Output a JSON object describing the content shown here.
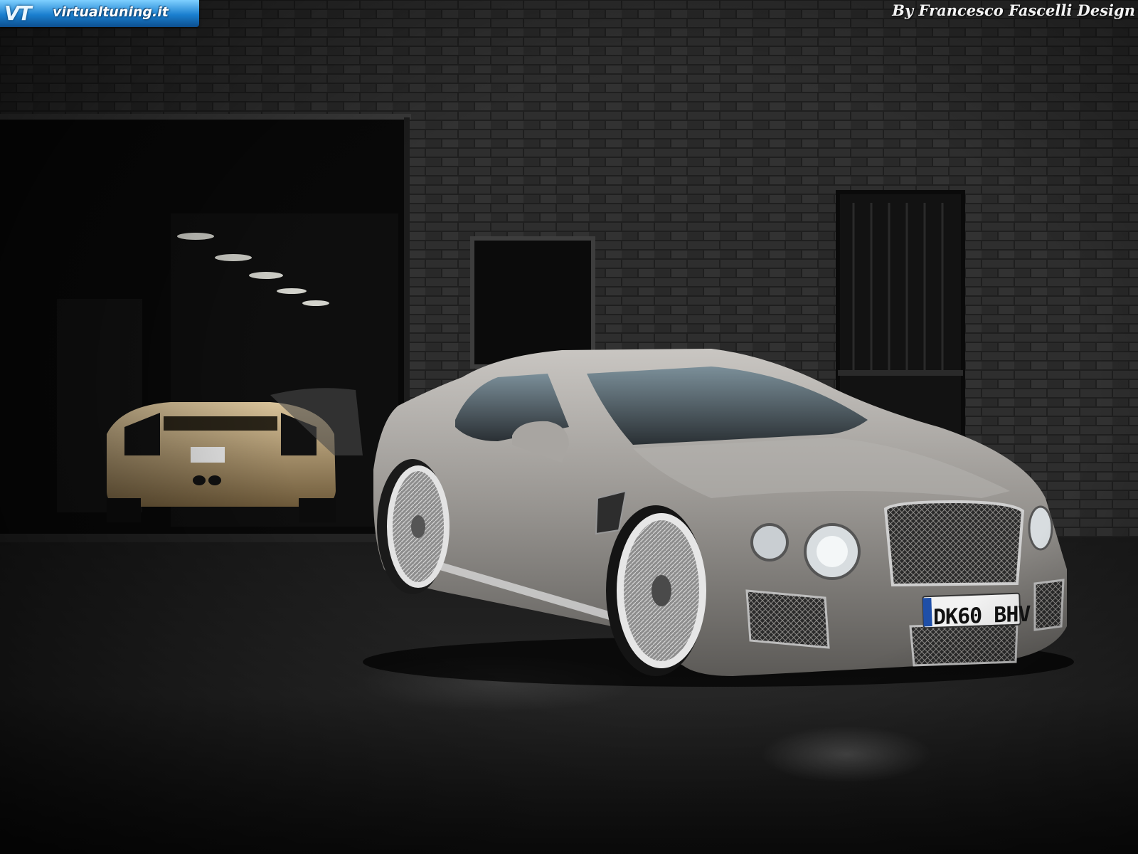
{
  "watermark": {
    "logo_mark": "VT",
    "logo_text": "virtualtuning.it"
  },
  "credit": "By Francesco Fascelli Design",
  "license_plate": "DK60 BHV",
  "colors": {
    "brick": "#2b2b2b",
    "ground": "#141414",
    "car_silver": "#9a9794",
    "garage_car_gold": "#c8ad7f",
    "logo_blue": "#1a7fcf"
  }
}
